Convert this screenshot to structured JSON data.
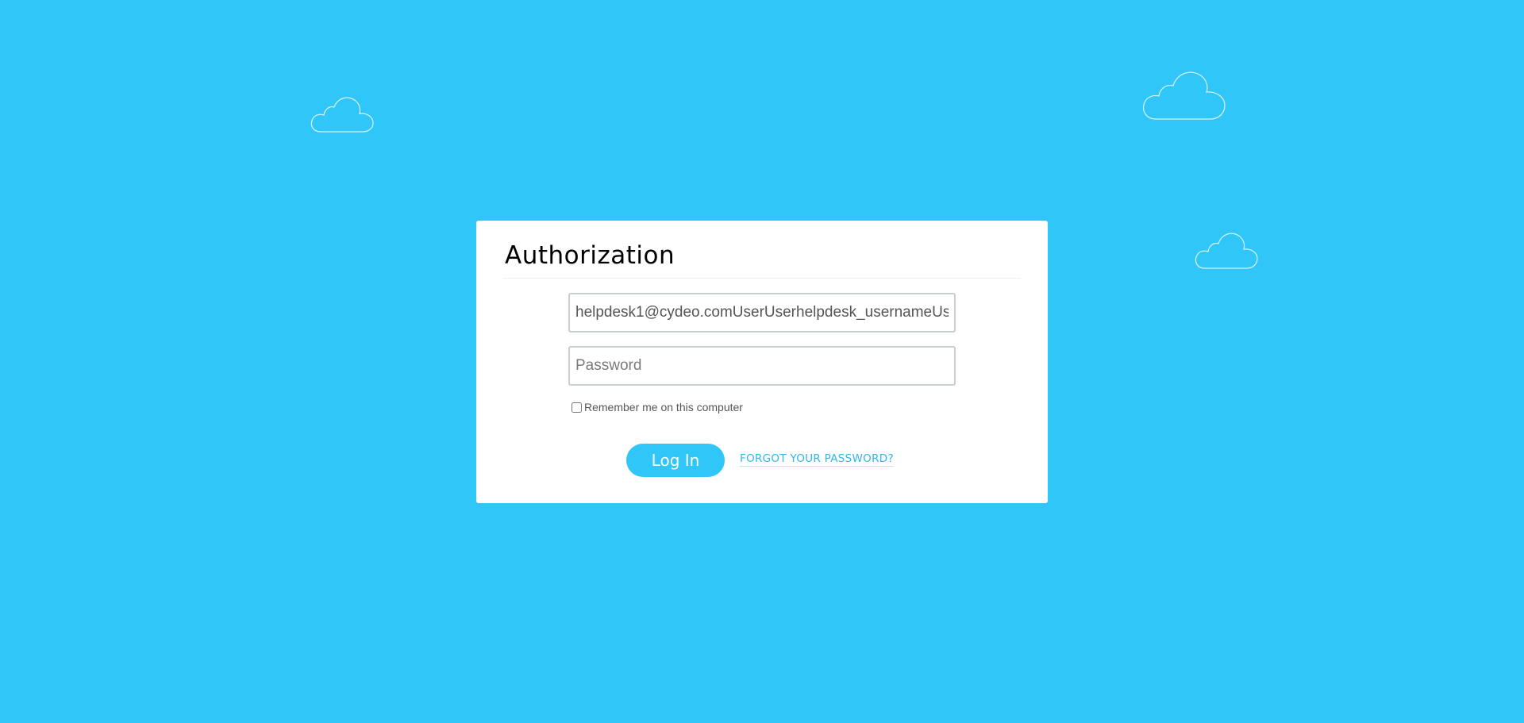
{
  "page": {
    "background_color": "#31c6f8"
  },
  "auth": {
    "title": "Authorization",
    "login": {
      "value": "helpdesk1@cydeo.comUserUserhelpdesk_usernameUs",
      "placeholder": ""
    },
    "password": {
      "value": "",
      "placeholder": "Password"
    },
    "remember": {
      "label": "Remember me on this computer",
      "checked": false
    },
    "login_button_label": "Log In",
    "forgot_link_label": "FORGOT YOUR PASSWORD?",
    "accent_color": "#31c6f8"
  },
  "decorations": {
    "clouds": [
      "cloud-icon",
      "cloud-icon",
      "cloud-icon"
    ]
  }
}
